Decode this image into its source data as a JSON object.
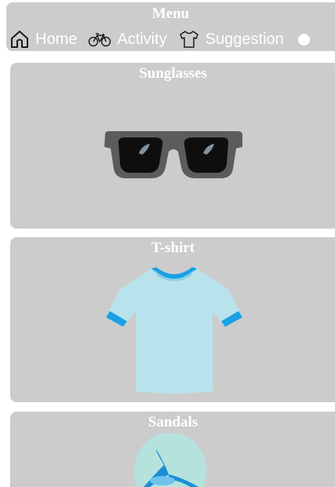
{
  "menu": {
    "title": "Menu",
    "items": [
      {
        "label": "Home",
        "icon": "home-icon"
      },
      {
        "label": "Activity",
        "icon": "bicycle-icon"
      },
      {
        "label": "Suggestion",
        "icon": "tshirt-icon"
      }
    ],
    "toggle_icon": "circle-toggle-icon"
  },
  "cards": [
    {
      "title": "Sunglasses",
      "image": "sunglasses"
    },
    {
      "title": "T-shirt",
      "image": "t-shirt"
    },
    {
      "title": "Sandals",
      "image": "sandals"
    }
  ],
  "colors": {
    "panel": "#cccccc",
    "text": "#ffffff",
    "shirt": "#b9e3ec",
    "shirt_trim": "#1aa0e6"
  }
}
